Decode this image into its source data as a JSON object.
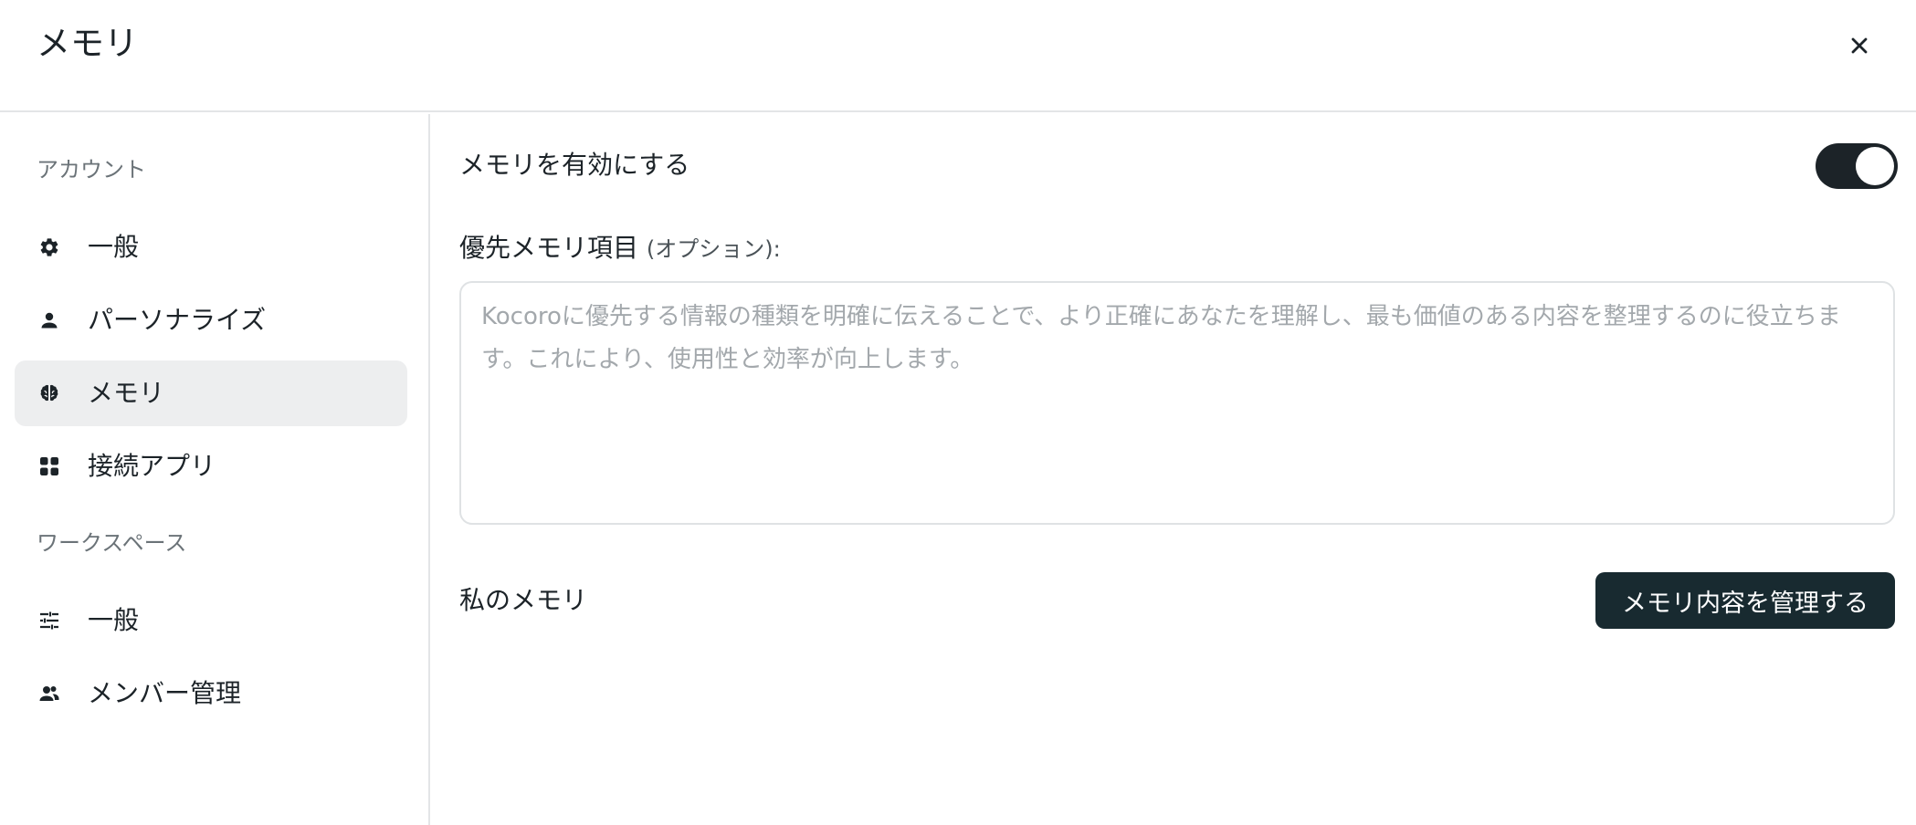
{
  "header": {
    "title": "メモリ"
  },
  "sidebar": {
    "account_section": "アカウント",
    "account_items": [
      {
        "label": "一般",
        "icon": "gear-icon"
      },
      {
        "label": "パーソナライズ",
        "icon": "person-icon"
      },
      {
        "label": "メモリ",
        "icon": "brain-icon",
        "active": true
      },
      {
        "label": "接続アプリ",
        "icon": "apps-grid-icon"
      }
    ],
    "workspace_section": "ワークスペース",
    "workspace_items": [
      {
        "label": "一般",
        "icon": "sliders-icon"
      },
      {
        "label": "メンバー管理",
        "icon": "members-icon"
      }
    ]
  },
  "main": {
    "enable_memory_label": "メモリを有効にする",
    "enable_memory_on": true,
    "priority_label": "優先メモリ項目",
    "priority_optional": "(オプション):",
    "priority_value": "",
    "priority_placeholder": "Kocoroに優先する情報の種類を明確に伝えることで、より正確にあなたを理解し、最も価値のある内容を整理するのに役立ちます。これにより、使用性と効率が向上します。",
    "my_memory_label": "私のメモリ",
    "manage_button": "メモリ内容を管理する"
  },
  "colors": {
    "text": "#1c2328",
    "active_bg": "#edeeef",
    "button_bg": "#182a30",
    "toggle_on": "#1c2328"
  }
}
